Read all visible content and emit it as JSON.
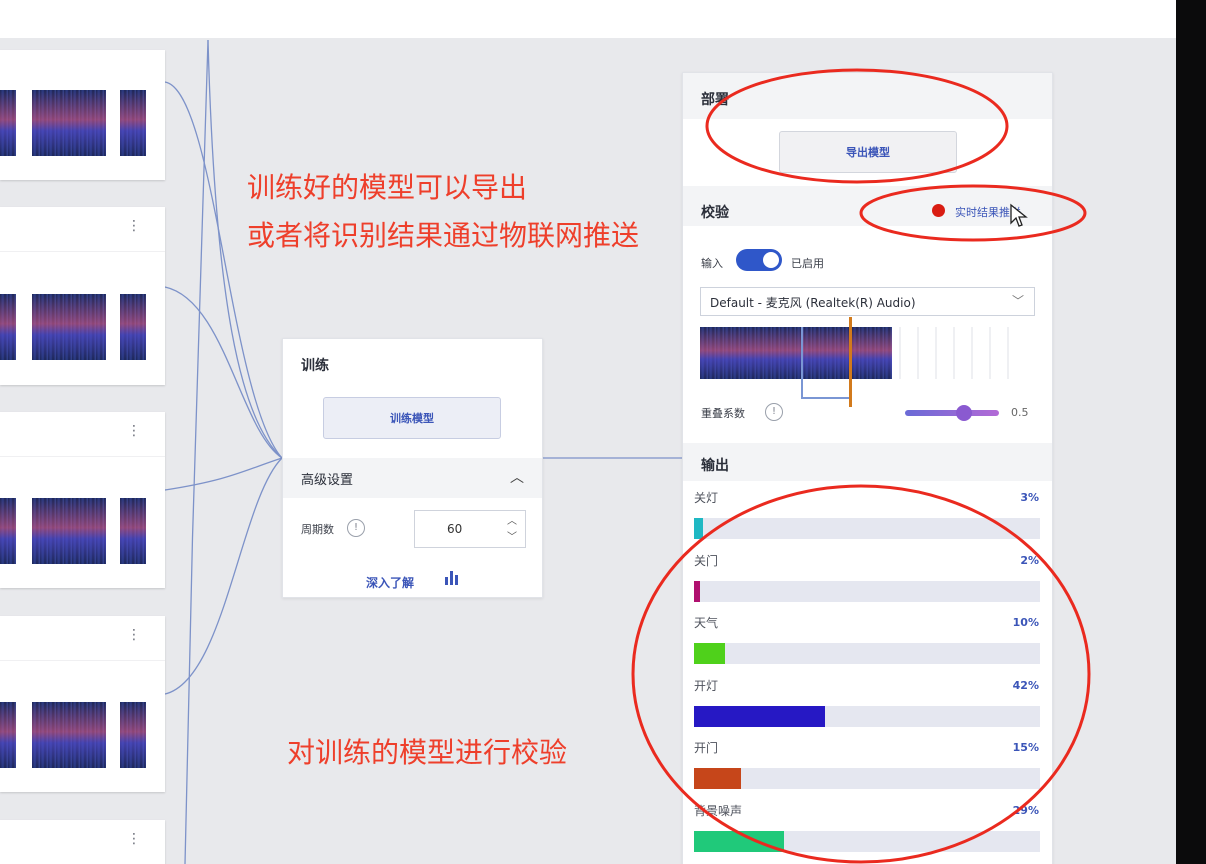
{
  "annotations": {
    "line1": "训练好的模型可以导出",
    "line2": "或者将识别结果通过物联网推送",
    "verify": "对训练的模型进行校验"
  },
  "train": {
    "title": "训练",
    "train_button": "训练模型",
    "advanced_title": "高级设置",
    "epochs_label": "周期数",
    "epochs_value": "60",
    "learn_more": "深入了解"
  },
  "deploy": {
    "title": "部署",
    "export_button": "导出模型"
  },
  "verify": {
    "title": "校验",
    "realtime_push": "实时结果推送",
    "input_label": "输入",
    "toggle_state": "已启用",
    "device_select": "Default - 麦克风 (Realtek(R) Audio)",
    "overlap_label": "重叠系数",
    "overlap_value": "0.5",
    "overlap_fraction": 0.5
  },
  "output": {
    "title": "输出",
    "classes": [
      {
        "label": "关灯",
        "pct": "3%",
        "value": 0.03,
        "color": "#1fb8c3"
      },
      {
        "label": "关门",
        "pct": "2%",
        "value": 0.02,
        "color": "#b0106f"
      },
      {
        "label": "天气",
        "pct": "10%",
        "value": 0.1,
        "color": "#4fd11b"
      },
      {
        "label": "开灯",
        "pct": "42%",
        "value": 0.42,
        "color": "#2618c4"
      },
      {
        "label": "开门",
        "pct": "15%",
        "value": 0.15,
        "color": "#c6461a"
      },
      {
        "label": "背景噪声",
        "pct": "29%",
        "value": 0.29,
        "color": "#20c97a"
      }
    ]
  },
  "colors": {
    "accent": "#3b55b8",
    "annotation": "#ee3f2b",
    "record": "#d91c12"
  }
}
